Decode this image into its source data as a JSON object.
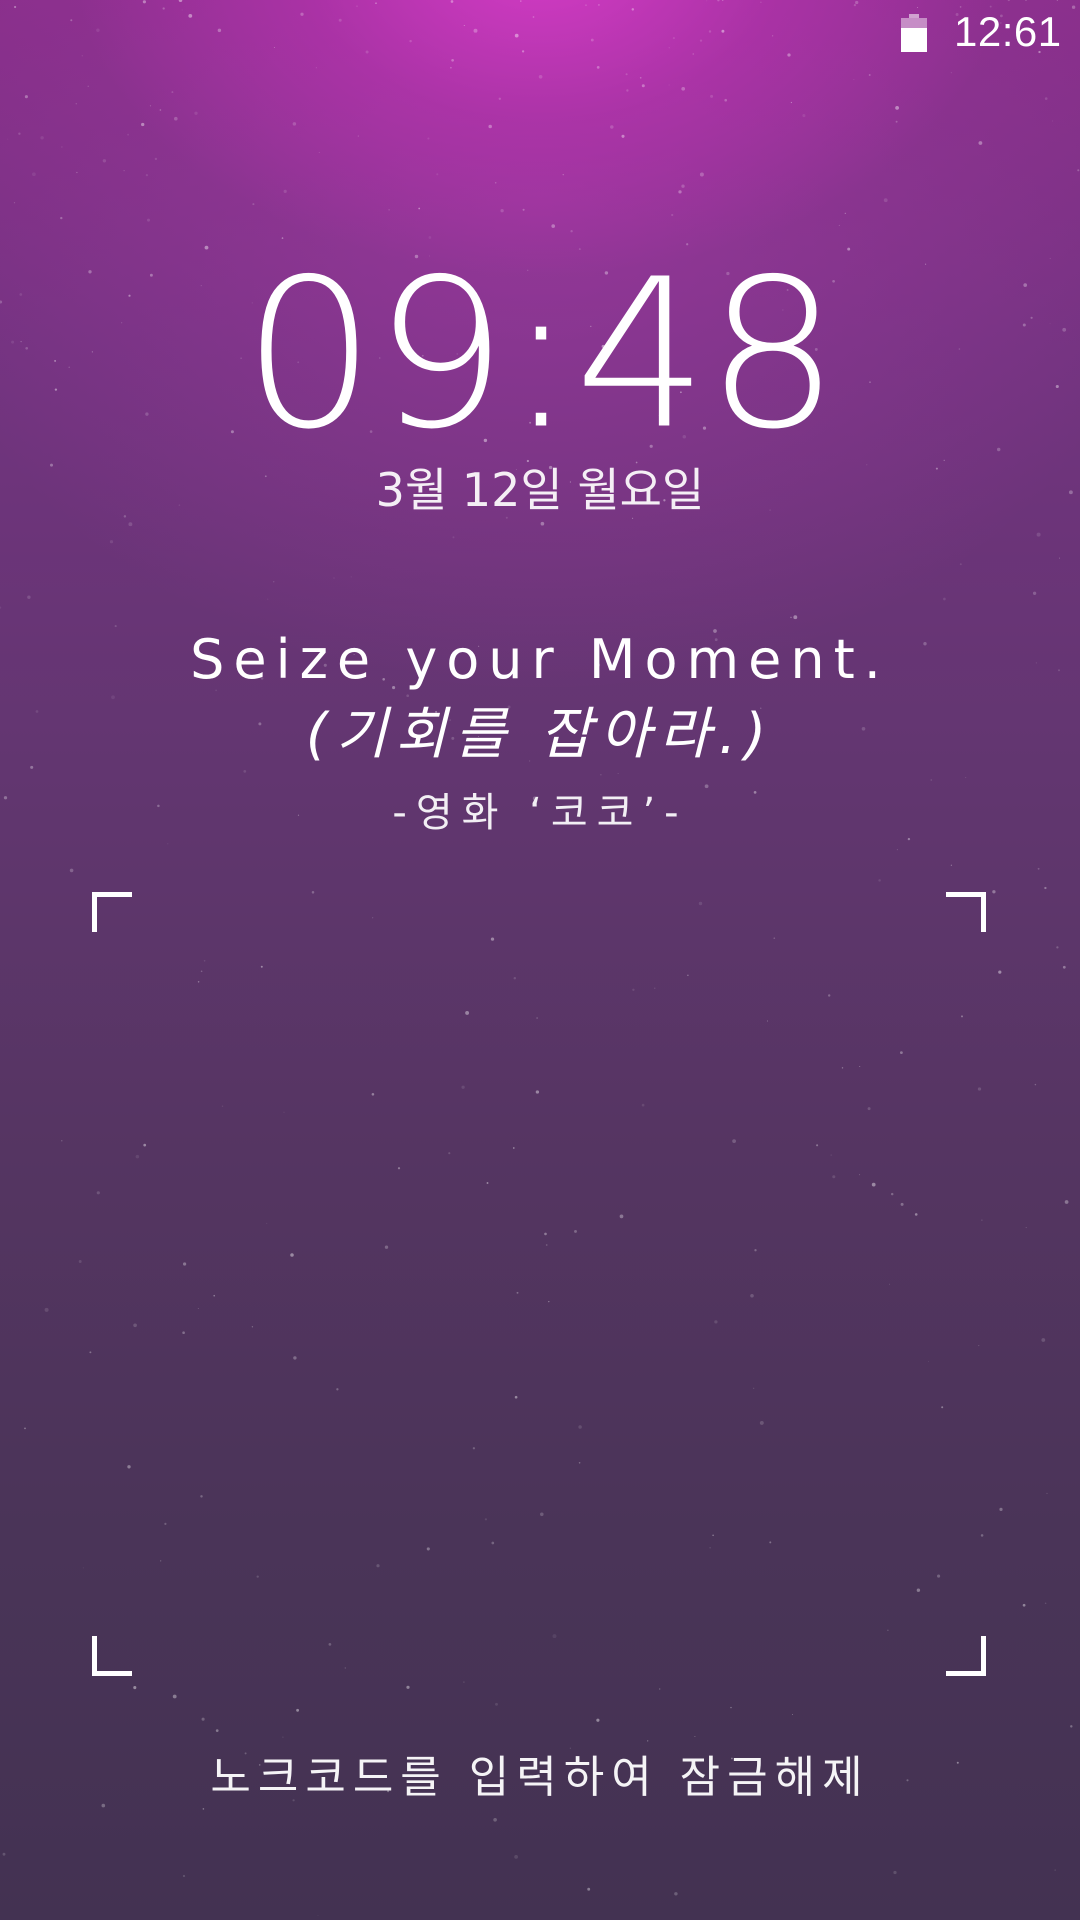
{
  "status_bar": {
    "time": "12:61",
    "battery_level_percent": 70
  },
  "lock_screen": {
    "clock": "09:48",
    "date": "3월 12일 월요일"
  },
  "quote": {
    "english": "Seize your Moment.",
    "korean": "(기회를 잡아라.)",
    "source": "-영화 ‘코코’-"
  },
  "knock_code": {
    "hint": "노크코드를 입력하여 잠금해제"
  },
  "colors": {
    "background_top": "#c12fb4",
    "background_mid": "#623670",
    "background_bottom": "#433252",
    "text": "#ffffff"
  },
  "icons": {
    "battery": "battery-icon"
  }
}
